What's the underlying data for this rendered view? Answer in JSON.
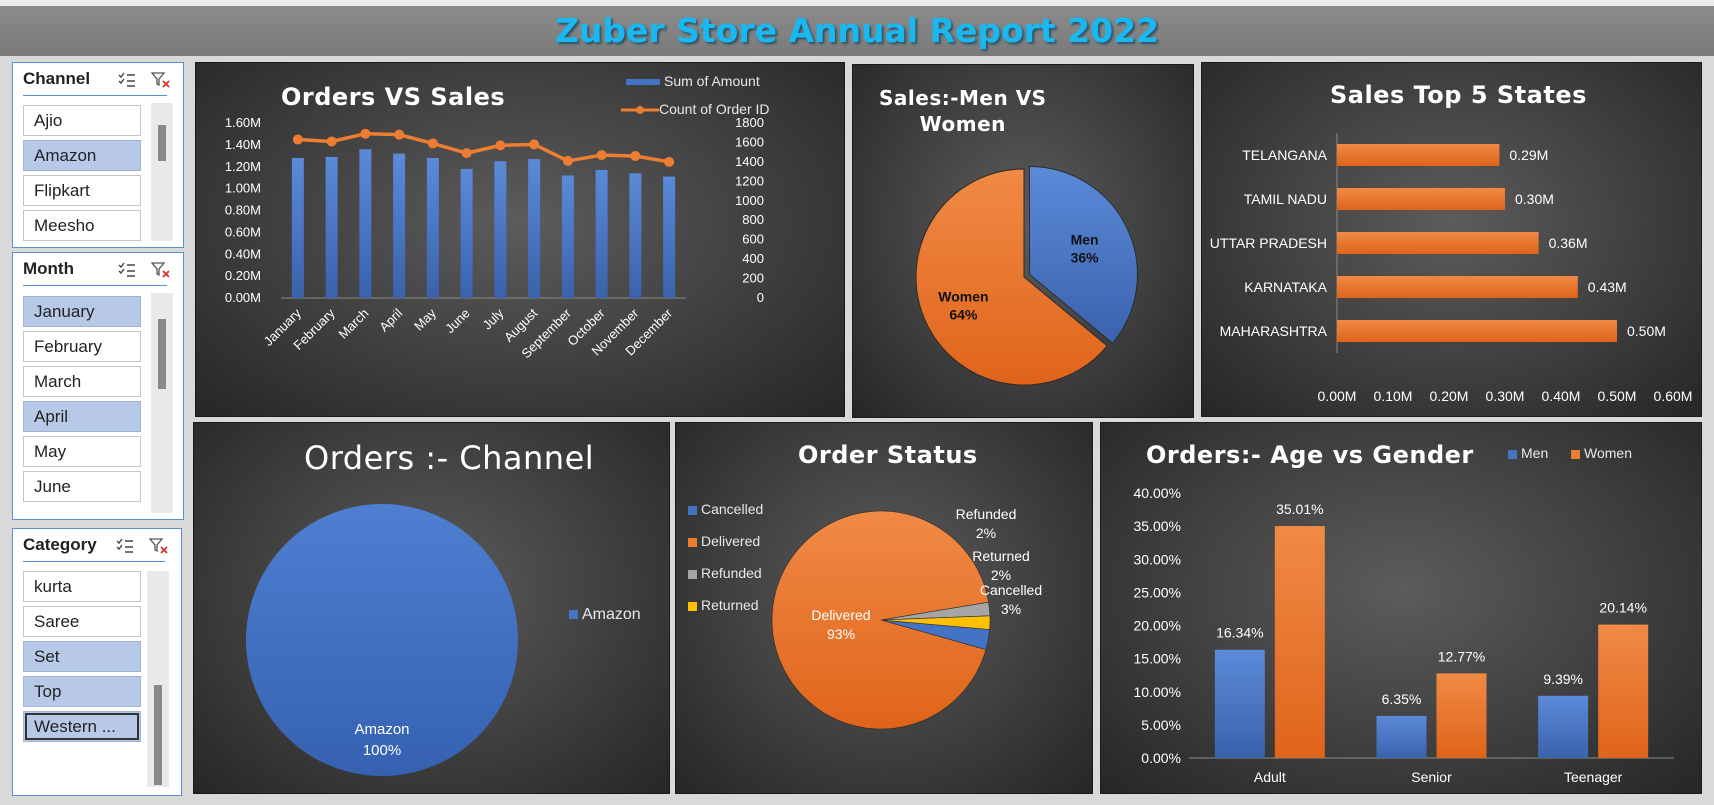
{
  "title": "Zuber Store Annual Report 2022",
  "colors": {
    "blue": "#4472c4",
    "orange": "#ed7d31",
    "gray": "#a5a5a5",
    "gold": "#ffc000",
    "title": "#19b8f0"
  },
  "slicers": {
    "channel": {
      "title": "Channel",
      "items": [
        {
          "label": "Ajio",
          "selected": false
        },
        {
          "label": "Amazon",
          "selected": true
        },
        {
          "label": "Flipkart",
          "selected": false
        },
        {
          "label": "Meesho",
          "selected": false
        }
      ]
    },
    "month": {
      "title": "Month",
      "items": [
        {
          "label": "January",
          "selected": true
        },
        {
          "label": "February",
          "selected": false
        },
        {
          "label": "March",
          "selected": false
        },
        {
          "label": "April",
          "selected": true
        },
        {
          "label": "May",
          "selected": false
        },
        {
          "label": "June",
          "selected": false
        }
      ]
    },
    "category": {
      "title": "Category",
      "items": [
        {
          "label": "kurta",
          "selected": false
        },
        {
          "label": "Saree",
          "selected": false
        },
        {
          "label": "Set",
          "selected": true
        },
        {
          "label": "Top",
          "selected": true
        },
        {
          "label": "Western ...",
          "selected": true
        }
      ]
    }
  },
  "chart_data": [
    {
      "type": "bar",
      "title": "Orders VS Sales",
      "categories": [
        "January",
        "February",
        "March",
        "April",
        "May",
        "June",
        "July",
        "August",
        "September",
        "October",
        "November",
        "December"
      ],
      "series": [
        {
          "name": "Sum of Amount",
          "type": "bar",
          "axis": "left",
          "values": [
            1.28,
            1.29,
            1.36,
            1.32,
            1.28,
            1.18,
            1.25,
            1.27,
            1.12,
            1.17,
            1.14,
            1.11
          ]
        },
        {
          "name": "Count of Order ID",
          "type": "line",
          "axis": "right",
          "values": [
            1630,
            1610,
            1690,
            1680,
            1590,
            1490,
            1570,
            1580,
            1410,
            1470,
            1460,
            1400
          ]
        }
      ],
      "y_ticks": [
        "0.00M",
        "0.20M",
        "0.40M",
        "0.60M",
        "0.80M",
        "1.00M",
        "1.20M",
        "1.40M",
        "1.60M"
      ],
      "y2_ticks": [
        "0",
        "200",
        "400",
        "600",
        "800",
        "1000",
        "1200",
        "1400",
        "1600",
        "1800"
      ],
      "ylim": [
        0,
        1.6
      ],
      "y2lim": [
        0,
        1800
      ]
    },
    {
      "type": "pie",
      "title": "Sales:-Men VS Women",
      "title_lines": [
        "Sales:-Men VS",
        "Women"
      ],
      "slices": [
        {
          "label": "Men",
          "value": 36,
          "text": "36%"
        },
        {
          "label": "Women",
          "value": 64,
          "text": "64%"
        }
      ]
    },
    {
      "type": "bar",
      "orientation": "horizontal",
      "title": "Sales Top 5 States",
      "categories": [
        "TELANGANA",
        "TAMIL NADU",
        "UTTAR PRADESH",
        "KARNATAKA",
        "MAHARASHTRA"
      ],
      "values": [
        0.29,
        0.3,
        0.36,
        0.43,
        0.5
      ],
      "labels": [
        "0.29M",
        "0.30M",
        "0.36M",
        "0.43M",
        "0.50M"
      ],
      "x_ticks": [
        "0.00M",
        "0.10M",
        "0.20M",
        "0.30M",
        "0.40M",
        "0.50M",
        "0.60M"
      ],
      "xlim": [
        0,
        0.6
      ]
    },
    {
      "type": "pie",
      "title": "Orders :- Channel",
      "slices": [
        {
          "label": "Amazon",
          "value": 100,
          "text": "100%"
        }
      ],
      "legend": [
        "Amazon"
      ]
    },
    {
      "type": "pie",
      "title": "Order Status",
      "slices": [
        {
          "label": "Cancelled",
          "value": 3,
          "text": "3%"
        },
        {
          "label": "Delivered",
          "value": 93,
          "text": "93%"
        },
        {
          "label": "Refunded",
          "value": 2,
          "text": "2%"
        },
        {
          "label": "Returned",
          "value": 2,
          "text": "2%"
        }
      ],
      "legend": [
        "Cancelled",
        "Delivered",
        "Refunded",
        "Returned"
      ]
    },
    {
      "type": "bar",
      "title": "Orders:- Age vs Gender",
      "categories": [
        "Adult",
        "Senior",
        "Teenager"
      ],
      "series": [
        {
          "name": "Men",
          "values": [
            16.34,
            6.35,
            9.39
          ],
          "labels": [
            "16.34%",
            "6.35%",
            "9.39%"
          ]
        },
        {
          "name": "Women",
          "values": [
            35.01,
            12.77,
            20.14
          ],
          "labels": [
            "35.01%",
            "12.77%",
            "20.14%"
          ]
        }
      ],
      "y_ticks": [
        "0.00%",
        "5.00%",
        "10.00%",
        "15.00%",
        "20.00%",
        "25.00%",
        "30.00%",
        "35.00%",
        "40.00%"
      ],
      "ylim": [
        0,
        40
      ]
    }
  ]
}
